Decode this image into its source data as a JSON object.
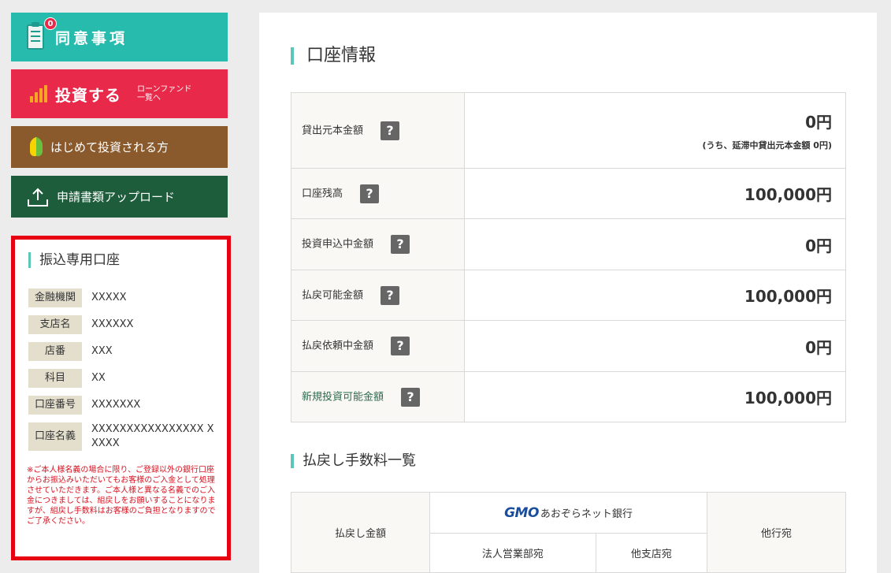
{
  "sidebar": {
    "agree": {
      "label": "同意事項",
      "badge": "0"
    },
    "invest": {
      "label": "投資する",
      "sub1": "ローンファンド",
      "sub2": "一覧へ"
    },
    "first": {
      "label": "はじめて投資される方"
    },
    "upload": {
      "label": "申請書類アップロード"
    }
  },
  "bank": {
    "title": "振込専用口座",
    "rows": [
      {
        "key": "金融機関",
        "value": "XXXXX"
      },
      {
        "key": "支店名",
        "value": "XXXXXX"
      },
      {
        "key": "店番",
        "value": "XXX"
      },
      {
        "key": "科目",
        "value": "XX"
      },
      {
        "key": "口座番号",
        "value": "XXXXXXX"
      },
      {
        "key": "口座名義",
        "value": "XXXXXXXXXXXXXXXX XXXXX"
      }
    ],
    "note": "※ご本人様名義の場合に限り、ご登録以外の銀行口座からお振込みいただいてもお客様のご入金として処理させていただきます。ご本人様と異なる名義でのご入金につきましては、組戻しをお願いすることになりますが、組戻し手数料はお客様のご負担となりますのでご了承ください。"
  },
  "account": {
    "title": "口座情報",
    "rows": [
      {
        "label": "貸出元本金額",
        "value": "0円",
        "note": "(うち、延滞中貸出元本金額 0円)"
      },
      {
        "label": "口座残高",
        "value": "100,000円"
      },
      {
        "label": "投資申込中金額",
        "value": "0円"
      },
      {
        "label": "払戻可能金額",
        "value": "100,000円"
      },
      {
        "label": "払戻依頼中金額",
        "value": "0円"
      },
      {
        "label": "新規投資可能金額",
        "value": "100,000円"
      }
    ],
    "help_icon": "?"
  },
  "fees": {
    "title": "払戻し手数料一覧",
    "col_amount": "払戻し金額",
    "bank_logo": "GMO",
    "bank_name": "あおぞらネット銀行",
    "sub_col1": "法人営業部宛",
    "sub_col2": "他支店宛",
    "col_other": "他行宛"
  },
  "colors": {
    "agree": "#27bbad",
    "invest": "#e8294a",
    "first": "#8a5a2c",
    "upload": "#1e5d3c",
    "bank_border": "#e60012",
    "accent": "#5cc7b8"
  }
}
